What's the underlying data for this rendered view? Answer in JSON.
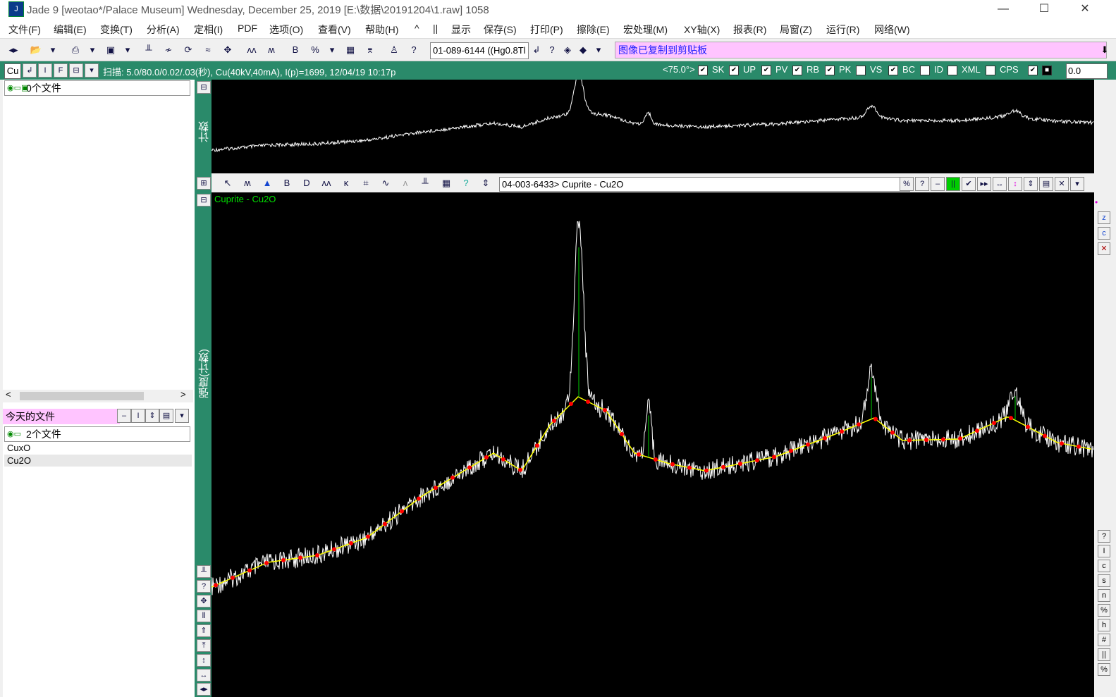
{
  "window": {
    "title": "Jade 9 [weotao*/Palace Museum] Wednesday, December 25, 2019 [E:\\数据\\20191204\\1.raw] 1058",
    "minimize": "—",
    "maximize": "☐",
    "close": "✕"
  },
  "menu": [
    "文件(F)",
    "编辑(E)",
    "变换(T)",
    "分析(A)",
    "定相(I)",
    "PDF",
    "选项(O)",
    "查看(V)",
    "帮助(H)",
    "^",
    "||",
    "显示",
    "保存(S)",
    "打印(P)",
    "擦除(E)",
    "宏处理(M)",
    "XY轴(X)",
    "报表(R)",
    "局窗(Z)",
    "运行(R)",
    "网络(W)"
  ],
  "toolbar": {
    "pdf_card": "01-089-6144 ((Hg0.8Tl",
    "message": "图像已复制到剪贴板"
  },
  "status": {
    "radiation": "Cu",
    "scan": "扫描: 5.0/80.0/0.02/.03(秒), Cu(40kV,40mA), I(p)=1699, 12/04/19 10:17p",
    "angle_label": "<75.0°>",
    "checks": [
      {
        "label": "SK",
        "checked": true
      },
      {
        "label": "UP",
        "checked": true
      },
      {
        "label": "PV",
        "checked": true
      },
      {
        "label": "RB",
        "checked": true
      },
      {
        "label": "PK",
        "checked": true
      },
      {
        "label": "VS",
        "checked": false
      },
      {
        "label": "BC",
        "checked": true
      },
      {
        "label": "ID",
        "checked": false
      },
      {
        "label": "XML",
        "checked": false
      },
      {
        "label": "CPS",
        "checked": false
      }
    ],
    "offset_value": "0.0"
  },
  "left_panel": {
    "folder_header": "0个文件",
    "today_label": "今天的文件",
    "files_header": "2个文件",
    "files": [
      "CuxO",
      "Cu2O"
    ]
  },
  "overview": {
    "ylabel": "计数"
  },
  "main_plot": {
    "ylabel": "强度(计数)",
    "card": "04-003-6433> Cuprite - Cu2O",
    "phase_label": "Cuprite - Cu2O"
  },
  "right_buttons": [
    "?",
    "I",
    "c",
    "s",
    "n",
    "%",
    "h",
    "#",
    "||",
    "%"
  ],
  "colors": {
    "status_green": "#2a8a6a",
    "message_pink": "#ffc4ff",
    "trace": "#ffffff",
    "background_line": "#ffff00",
    "background_points": "#ff0000",
    "pdf_sticks": "#00cc00"
  }
}
